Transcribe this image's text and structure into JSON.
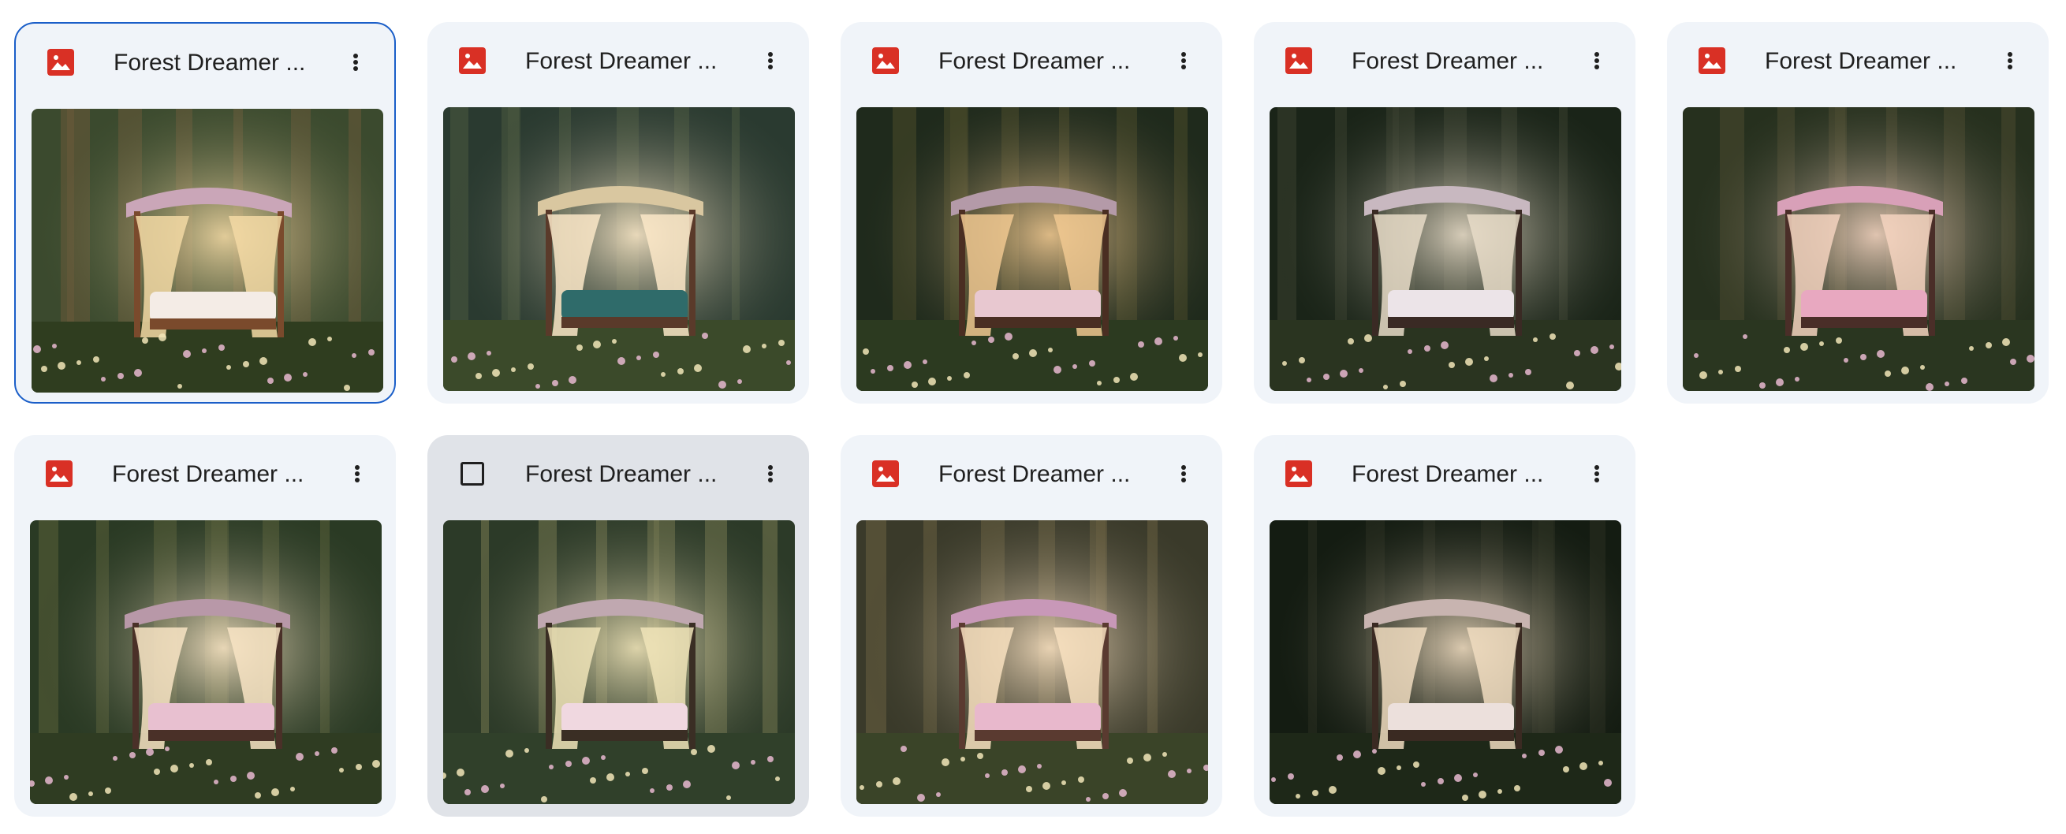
{
  "files": [
    {
      "title": "Forest Dreamer ...",
      "icon": "image-icon",
      "state": "selected",
      "palette": "warm"
    },
    {
      "title": "Forest Dreamer ...",
      "icon": "image-icon",
      "state": "normal",
      "palette": "teal"
    },
    {
      "title": "Forest Dreamer ...",
      "icon": "image-icon",
      "state": "normal",
      "palette": "sunset"
    },
    {
      "title": "Forest Dreamer ...",
      "icon": "image-icon",
      "state": "normal",
      "palette": "lantern"
    },
    {
      "title": "Forest Dreamer ...",
      "icon": "image-icon",
      "state": "normal",
      "palette": "pink"
    },
    {
      "title": "Forest Dreamer ...",
      "icon": "image-icon",
      "state": "normal",
      "palette": "canopy"
    },
    {
      "title": "Forest Dreamer ...",
      "icon": "checkbox-icon",
      "state": "hovered",
      "palette": "mist"
    },
    {
      "title": "Forest Dreamer ...",
      "icon": "image-icon",
      "state": "normal",
      "palette": "blossom"
    },
    {
      "title": "Forest Dreamer ...",
      "icon": "image-icon",
      "state": "normal",
      "palette": "night"
    }
  ],
  "colors": {
    "image_icon": "#d93025",
    "selected_border": "#1a5ec8",
    "card_bg": "#f0f4f9",
    "card_hover_bg": "#e0e3e8"
  }
}
